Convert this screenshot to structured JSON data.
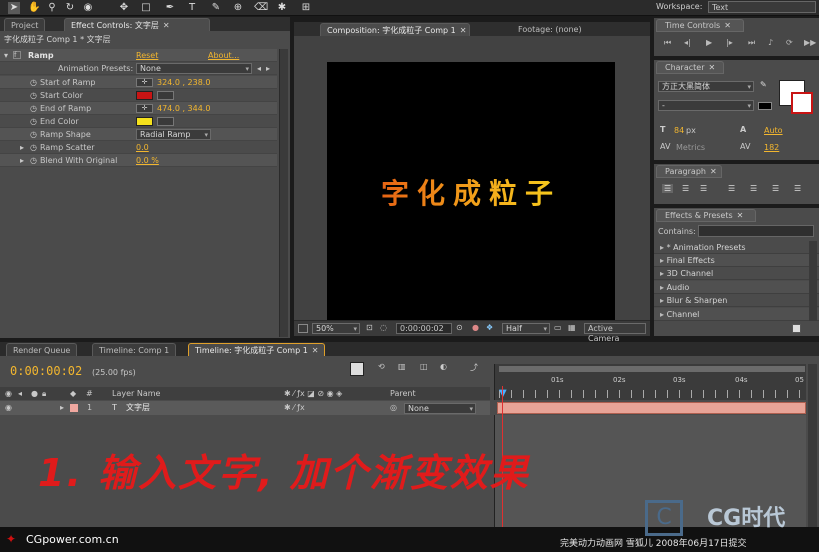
{
  "toolbar": {
    "workspace_label": "Workspace:",
    "workspace_value": "Text"
  },
  "left_panel": {
    "tabs": [
      {
        "label": "Project"
      },
      {
        "label": "Effect Controls: 文字层"
      }
    ],
    "breadcrumb": "字化成粒子 Comp 1 * 文字层",
    "effect": {
      "name": "Ramp",
      "reset": "Reset",
      "about": "About...",
      "presets_label": "Animation Presets:",
      "presets_value": "None",
      "props": [
        {
          "label": "Start of Ramp",
          "value": "324.0 , 238.0"
        },
        {
          "label": "Start Color",
          "color": "#c81414"
        },
        {
          "label": "End of Ramp",
          "value": "474.0 , 344.0"
        },
        {
          "label": "End Color",
          "color": "#f5e11c"
        },
        {
          "label": "Ramp Shape",
          "value": "Radial Ramp"
        },
        {
          "label": "Ramp Scatter",
          "value": "0.0"
        },
        {
          "label": "Blend With Original",
          "value": "0.0 %"
        }
      ]
    }
  },
  "comp_panel": {
    "tabs": [
      {
        "label": "Composition: 字化成粒子 Comp 1"
      },
      {
        "label": "Footage: (none)"
      }
    ],
    "canvas_text": "字化成粒子",
    "zoom": "50%",
    "timecode": "0:00:00:02",
    "resolution": "Half",
    "camera": "Active Camera"
  },
  "right_panels": {
    "time_controls": "Time Controls",
    "character": {
      "title": "Character",
      "font": "方正大黑简体",
      "style": "-",
      "size": "84",
      "size_unit": "px",
      "leading": "Auto",
      "kerning": "Metrics",
      "tracking": "182"
    },
    "paragraph": "Paragraph",
    "effects_presets": {
      "title": "Effects & Presets",
      "contains_label": "Contains:",
      "items": [
        "* Animation Presets",
        "Final Effects",
        "3D Channel",
        "Audio",
        "Blur & Sharpen",
        "Channel"
      ]
    }
  },
  "timeline": {
    "tabs": [
      {
        "label": "Render Queue"
      },
      {
        "label": "Timeline: Comp 1"
      },
      {
        "label": "Timeline: 字化成粒子 Comp 1"
      }
    ],
    "timecode": "0:00:00:02",
    "fps": "(25.00 fps)",
    "col_number": "#",
    "col_layer_name": "Layer Name",
    "col_parent": "Parent",
    "ruler": [
      "01s",
      "02s",
      "03s",
      "04s",
      "05"
    ],
    "layer": {
      "index": "1",
      "name": "文字层",
      "parent": "None"
    }
  },
  "overlay": {
    "instruction": "1. 输入文字, 加个渐变效果",
    "watermark_left": "CGpower.com.cn",
    "watermark_right": "完美动力动画网 雪狐儿 2008年06月17日提交",
    "logo_text": "CG时代"
  },
  "colors": {
    "accent": "#f2b62f",
    "instruction_red": "#e01b1b"
  }
}
